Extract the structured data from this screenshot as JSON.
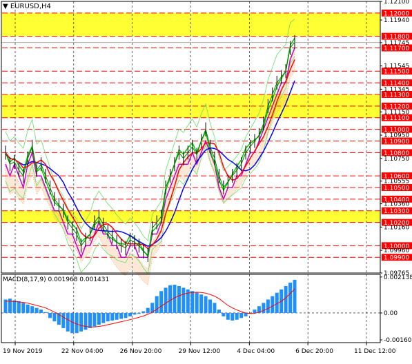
{
  "header": {
    "symbol_label": "EURUSD,H4"
  },
  "macd": {
    "label": "MACD(8,17,9) 0.001968 0.001431"
  },
  "colors": {
    "zone": "#ffff33",
    "level_line": "#ff0000",
    "price": "#008000",
    "ma_red": "#ff0000",
    "ma_blue": "#0000ff",
    "envelope": "#cc00cc",
    "tenkan": "#00cc00",
    "band": "#66dd66",
    "cloud": "#f4a460",
    "macd_hist": "#1e90ff",
    "macd_signal": "#ff0000"
  },
  "chart_data": [
    {
      "type": "line",
      "symbol": "EURUSD",
      "timeframe": "H4",
      "ylim": [
        1.09765,
        1.121
      ],
      "yticks": [
        "1.12100",
        "1.11940",
        "1.11745",
        "1.11545",
        "1.11345",
        "1.11150",
        "1.10950",
        "1.10750",
        "1.10555",
        "1.10360",
        "1.10160",
        "1.09960",
        "1.09765"
      ],
      "xticks": [
        "19 Nov 2019",
        "22 Nov 04:00",
        "26 Nov 20:00",
        "29 Nov 12:00",
        "4 Dec 04:00",
        "6 Dec 20:00",
        "11 Dec 12:00"
      ],
      "levels": [
        "1.12000",
        "1.11800",
        "1.11700",
        "1.11500",
        "1.11400",
        "1.11300",
        "1.11200",
        "1.11100",
        "1.11000",
        "1.10900",
        "1.10800",
        "1.10600",
        "1.10500",
        "1.10400",
        "1.10300",
        "1.10200",
        "1.10000",
        "1.09900"
      ],
      "zones": [
        {
          "from": 1.118,
          "to": 1.12
        },
        {
          "from": 1.111,
          "to": 1.113
        },
        {
          "from": 1.102,
          "to": 1.103
        }
      ],
      "current_price": "1.11746",
      "series": [
        {
          "values": [
            1.108,
            1.107,
            1.1072,
            1.1065,
            1.106,
            1.1075,
            1.1085,
            1.1065,
            1.107,
            1.106,
            1.105,
            1.104,
            1.1035,
            1.103,
            1.102,
            1.1015,
            1.101,
            1.1,
            1.1005,
            1.101,
            1.102,
            1.1025,
            1.1018,
            1.1012,
            1.1008,
            1.1003,
            1.1,
            1.0998,
            1.1005,
            1.1003,
            1.1,
            1.0995,
            1.0992,
            1.1015,
            1.102,
            1.1025,
            1.105,
            1.106,
            1.107,
            1.108,
            1.1075,
            1.108,
            1.1085,
            1.1078,
            1.109,
            1.11,
            1.1085,
            1.1075,
            1.106,
            1.105,
            1.1055,
            1.106,
            1.1065,
            1.107,
            1.108,
            1.1085,
            1.109,
            1.1095,
            1.1105,
            1.112,
            1.113,
            1.114,
            1.1145,
            1.115,
            1.117,
            1.1175
          ]
        }
      ]
    },
    {
      "type": "bar",
      "title": "MACD(8,17,9)",
      "macd": "0.001968",
      "signal": "0.001431",
      "ylim": [
        -0.0016,
        0.00213
      ],
      "yticks": [
        "0.002138",
        "0.00",
        "-0.001602"
      ],
      "series": [
        {
          "values": [
            0.0008,
            0.00085,
            0.00075,
            0.0007,
            0.0006,
            0.0005,
            0.0004,
            0.0003,
            0.0002,
            5e-05,
            -0.0003,
            -0.0005,
            -0.0007,
            -0.0009,
            -0.0011,
            -0.0012,
            -0.0012,
            -0.0011,
            -0.001,
            -0.0009,
            -0.0008,
            -0.0007,
            -0.0006,
            -0.0005,
            -0.00045,
            -0.0004,
            -0.00035,
            -0.0003,
            -0.0002,
            -0.0001,
            -5e-05,
            0.0001,
            0.0003,
            0.0006,
            0.001,
            0.0013,
            0.0015,
            0.00165,
            0.00168,
            0.0016,
            0.0015,
            0.0014,
            0.0013,
            0.0012,
            0.0011,
            0.001,
            0.0008,
            0.0006,
            0.0002,
            -0.0002,
            -0.0004,
            -0.00045,
            -0.0004,
            -0.0003,
            -0.0002,
            0.0,
            0.0002,
            0.0004,
            0.0006,
            0.0008,
            0.001,
            0.0012,
            0.0014,
            0.0016,
            0.0018,
            0.00197
          ]
        },
        {
          "values": [
            0.0007,
            0.0007,
            0.00068,
            0.00066,
            0.00063,
            0.00058,
            0.00052,
            0.00045,
            0.00038,
            0.0003,
            0.00018,
            5e-05,
            -0.0001,
            -0.00025,
            -0.0004,
            -0.00055,
            -0.00065,
            -0.00075,
            -0.0008,
            -0.00083,
            -0.00083,
            -0.0008,
            -0.00076,
            -0.0007,
            -0.00064,
            -0.00058,
            -0.00052,
            -0.00046,
            -0.0004,
            -0.00033,
            -0.00026,
            -0.00018,
            -8e-05,
            5e-05,
            0.00022,
            0.0004,
            0.00058,
            0.00075,
            0.0009,
            0.00102,
            0.00112,
            0.00118,
            0.00122,
            0.00123,
            0.00122,
            0.00118,
            0.0011,
            0.001,
            0.00085,
            0.00065,
            0.00045,
            0.0003,
            0.00018,
            8e-05,
            0.0,
            -4e-05,
            -2e-05,
            5e-05,
            0.00015,
            0.00027,
            0.0004,
            0.00055,
            0.0007,
            0.0009,
            0.00115,
            0.00143
          ]
        }
      ]
    }
  ]
}
